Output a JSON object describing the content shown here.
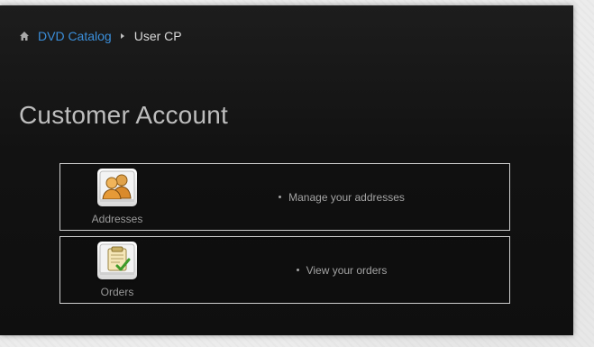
{
  "breadcrumb": {
    "home_icon": "home-icon",
    "link_label": "DVD Catalog",
    "current_label": "User CP",
    "link_color": "#3b8fdb"
  },
  "page": {
    "title": "Customer Account"
  },
  "account_items": [
    {
      "icon": "addresses-icon",
      "label": "Addresses",
      "description": "Manage your addresses"
    },
    {
      "icon": "orders-icon",
      "label": "Orders",
      "description": "View your orders"
    }
  ]
}
